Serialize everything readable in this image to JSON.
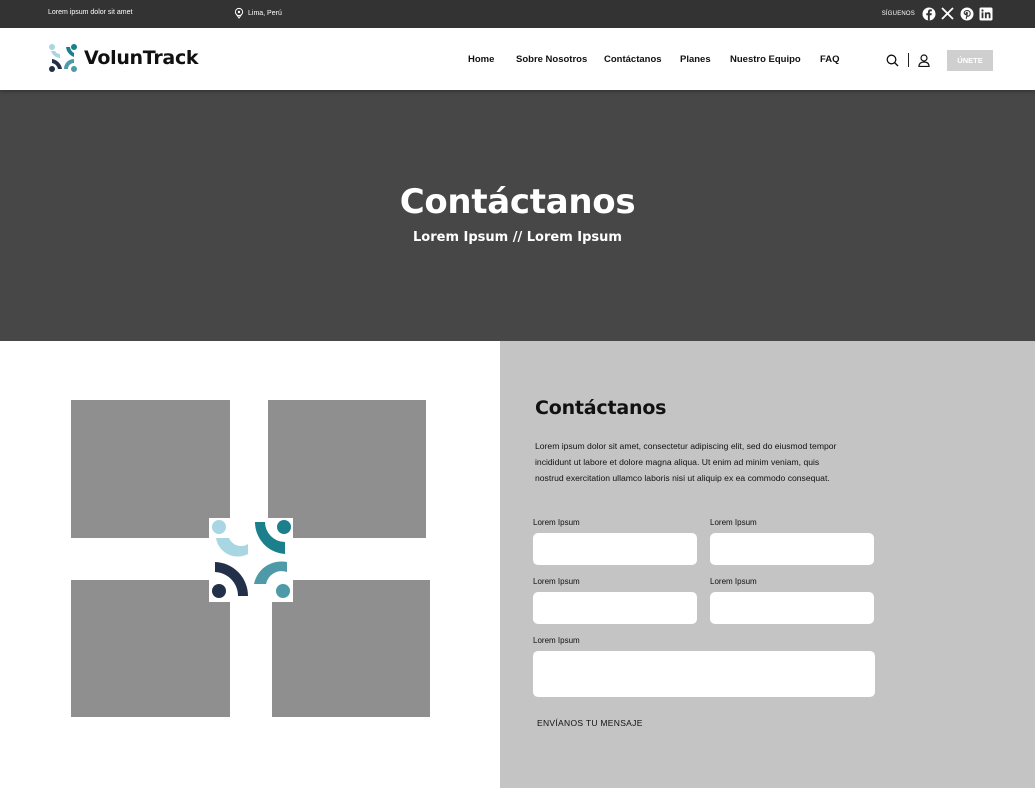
{
  "topbar": {
    "tagline": "Lorem ipsum dolor sit amet",
    "location": "Lima, Perú",
    "location_icon": "map-pin-icon",
    "follow_label": "SÍGUENOS",
    "social": [
      {
        "name": "facebook-icon"
      },
      {
        "name": "x-icon"
      },
      {
        "name": "pinterest-icon"
      },
      {
        "name": "linkedin-icon"
      }
    ]
  },
  "header": {
    "brand": "VolunTrack",
    "nav": [
      "Home",
      "Sobre Nosotros",
      "Contáctanos",
      "Planes",
      "Nuestro Equipo",
      "FAQ"
    ],
    "icons": [
      "search-icon",
      "user-icon"
    ],
    "cta_label": "ÚNETE"
  },
  "hero": {
    "title": "Contáctanos",
    "breadcrumb": "Lorem Ipsum // Lorem Ipsum"
  },
  "contact": {
    "title": "Contáctanos",
    "description": "Lorem ipsum dolor sit amet, consectetur adipiscing elit, sed do eiusmod tempor incididunt ut labore et dolore magna aliqua. Ut enim ad minim veniam, quis nostrud exercitation ullamco laboris nisi ut aliquip ex ea commodo consequat.",
    "fields": [
      {
        "label": "Lorem Ipsum",
        "value": "",
        "placeholder": ""
      },
      {
        "label": "Lorem Ipsum",
        "value": "",
        "placeholder": ""
      },
      {
        "label": "Lorem Ipsum",
        "value": "",
        "placeholder": ""
      },
      {
        "label": "Lorem Ipsum",
        "value": "",
        "placeholder": ""
      }
    ],
    "message": {
      "label": "Lorem Ipsum",
      "value": "",
      "placeholder": ""
    },
    "submit_label": "ENVÍANOS TU MENSAJE"
  },
  "colors": {
    "topbar": "#333333",
    "hero": "#474747",
    "panel": "#c4c4c4",
    "placeholder_image": "#8f8f8f",
    "brand_light": "#a9d6e3",
    "brand_teal": "#1b7f8c",
    "brand_navy": "#223049",
    "brand_mid": "#4f9aa8"
  }
}
